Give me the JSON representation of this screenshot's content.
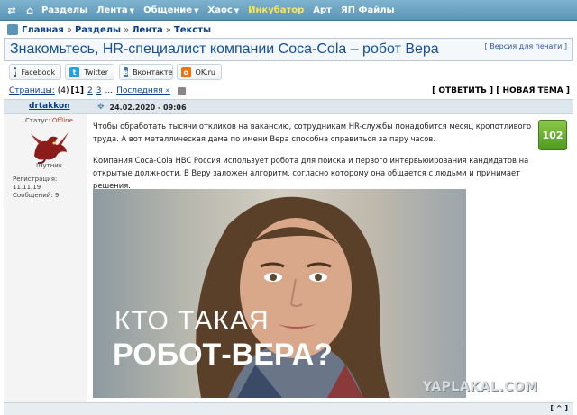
{
  "topnav": {
    "items": [
      {
        "label": "Разделы",
        "dropdown": false
      },
      {
        "label": "Лента",
        "dropdown": true
      },
      {
        "label": "Общение",
        "dropdown": true
      },
      {
        "label": "Хаос",
        "dropdown": true
      },
      {
        "label": "Инкубатор",
        "dropdown": false
      },
      {
        "label": "Арт",
        "dropdown": false
      },
      {
        "label": "ЯП Файлы",
        "dropdown": false
      }
    ]
  },
  "breadcrumb": {
    "items": [
      "Главная",
      "Разделы",
      "Лента",
      "Тексты"
    ],
    "separator": "»"
  },
  "topic": {
    "title": "Знакомьтесь, HR-специалист компании Coca-Cola – робот Вера",
    "version_link": "Версия для печати"
  },
  "share": [
    {
      "label": "Facebook",
      "icon": "facebook-icon",
      "color": "#3b5998",
      "glyph": "f"
    },
    {
      "label": "Twitter",
      "icon": "twitter-icon",
      "color": "#1da1f2",
      "glyph": "t"
    },
    {
      "label": "Вконтакте",
      "icon": "vk-icon",
      "color": "#4a76a8",
      "glyph": "в"
    },
    {
      "label": "OK.ru",
      "icon": "ok-icon",
      "color": "#f2720c",
      "glyph": "o"
    }
  ],
  "pagination": {
    "label": "Страницы:",
    "count": "(4)",
    "current": "[1]",
    "pages": [
      "2",
      "3"
    ],
    "ellipsis": "...",
    "last": "Последняя »"
  },
  "actions": {
    "reply": "[ ОТВЕТИТЬ ]",
    "new_topic": "[ НОВАЯ ТЕМА ]"
  },
  "post": {
    "author": "drtakkon",
    "date": "24.02.2020 - 09:06",
    "status_label": "Статус:",
    "status_value": "Offline",
    "rank": "Шутник",
    "registered": "Регистрация: 11.11.19",
    "messages": "Сообщений: 9",
    "rating": "102",
    "paragraphs": [
      "Чтобы обработать тысячи откликов на вакансию, сотрудникам HR-службы понадобится месяц кропотливого труда. А вот металлическая дама по имени Вера способна справиться за пару часов.",
      "Компания Coca-Cola HBC Россия использует робота для поиска и первого интервьюирования кандидатов на открытые должности. В Веру заложен алгоритм, согласно которому она общается с людьми и принимает решения."
    ],
    "image_line1": "КТО ТАКАЯ",
    "image_line2": "РОБОТ-ВЕРА?"
  },
  "watermark": "YAPLAKAL.COM",
  "footer": {
    "more": "[ ^ ]"
  }
}
